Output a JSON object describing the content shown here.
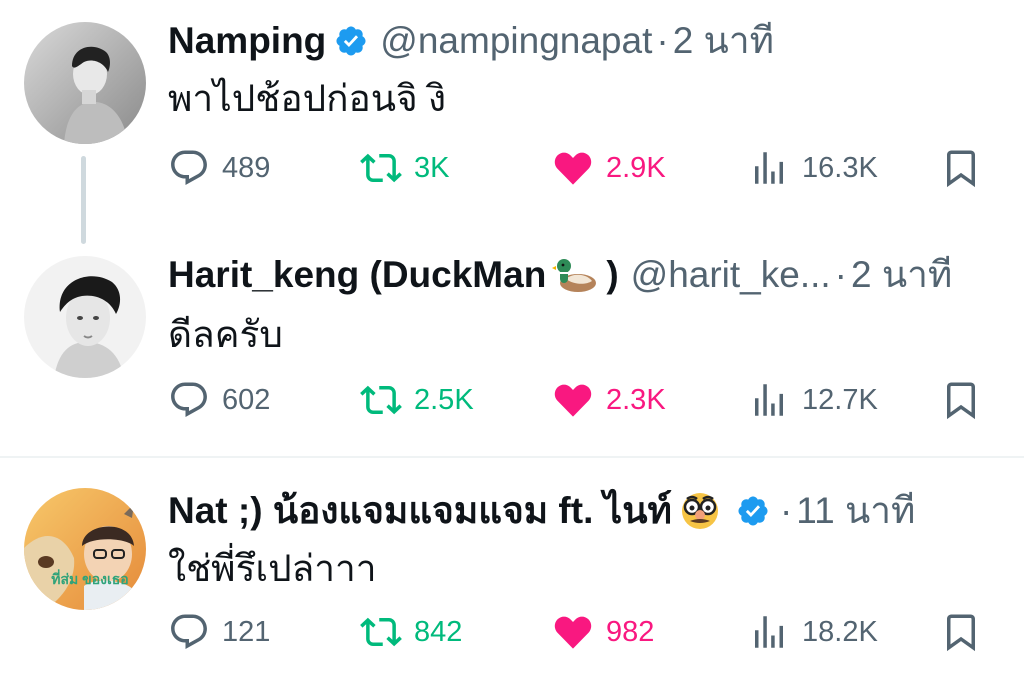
{
  "tweets": [
    {
      "name": "Namping",
      "verified": true,
      "handle": "@nampingnapat",
      "separator": "·",
      "time": "2 นาที",
      "text": "พาไปช้อปก่อนจิ งิ",
      "avatar": "avatar-namping",
      "stats": {
        "replies": "489",
        "retweets": "3K",
        "likes": "2.9K",
        "views": "16.3K"
      }
    },
    {
      "name": "Harit_keng (DuckMan",
      "name_emoji": "duck-emoji",
      "name_end": ")",
      "handle": "@harit_ke...",
      "separator": "·",
      "time": "2 นาที",
      "text": "ดีลครับ",
      "avatar": "avatar-harit",
      "stats": {
        "replies": "602",
        "retweets": "2.5K",
        "likes": "2.3K",
        "views": "12.7K"
      }
    },
    {
      "name": "Nat ;) น้องแจมแจมแจม ft. ไนท์",
      "name_emoji": "disguised-face-emoji",
      "verified": true,
      "separator": "·",
      "time": "11 นาที",
      "text": "ใช่พี่รึเปล่าาา",
      "avatar": "avatar-nat",
      "avatar_text": "ที่ส่ม ของเธอ",
      "stats": {
        "replies": "121",
        "retweets": "842",
        "likes": "982",
        "views": "18.2K"
      }
    }
  ],
  "icons": {
    "reply": "reply-icon",
    "retweet": "retweet-icon",
    "like": "heart-icon",
    "views": "views-icon",
    "bookmark": "bookmark-icon",
    "verified": "verified-badge-icon"
  },
  "colors": {
    "verified": "#1d9bf0",
    "retweet_active": "#00ba7c",
    "like_active": "#f91880",
    "muted": "#536471",
    "text": "#0f1419"
  }
}
